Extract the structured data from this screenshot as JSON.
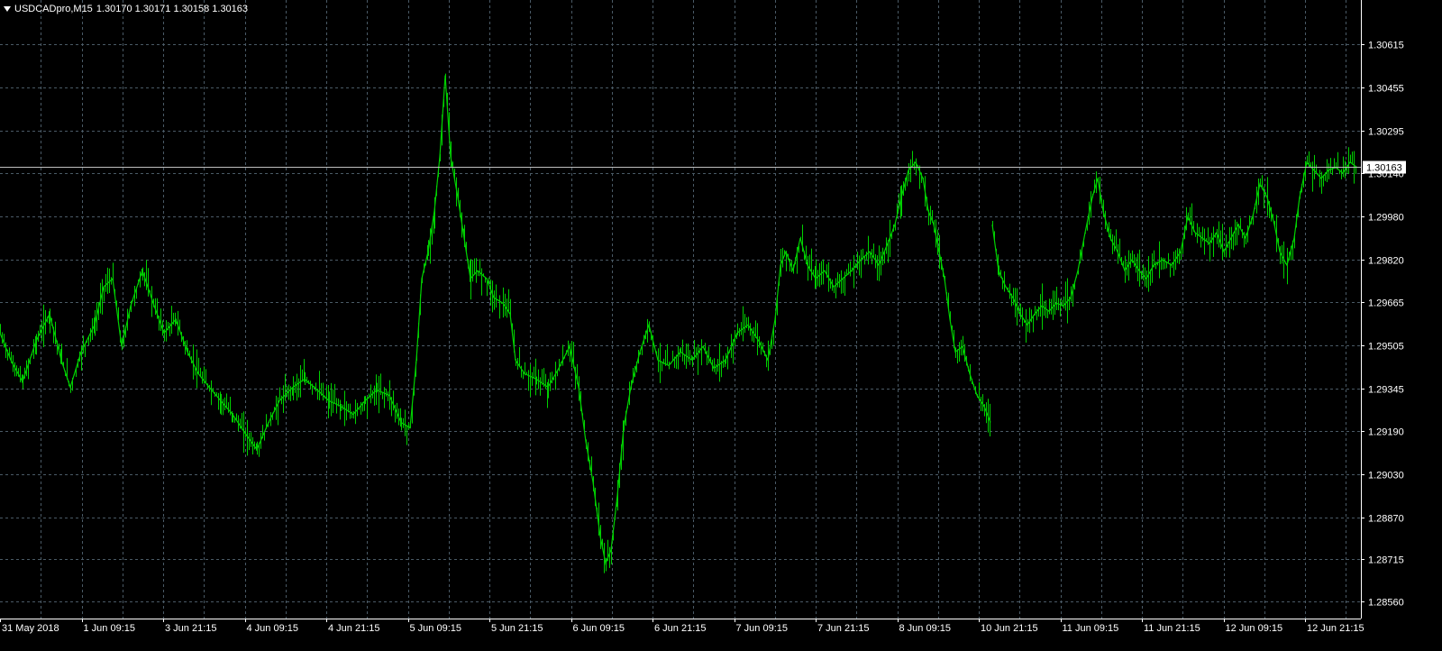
{
  "header": {
    "symbol": "USDCADpro",
    "timeframe": "M15",
    "symbol_timeframe": "USDCADpro,M15",
    "ohlc_text": "1.30170 1.30171 1.30158 1.30163"
  },
  "colors": {
    "background": "#000000",
    "grid": "#4a5a66",
    "bars": "#00d000",
    "axis_text": "#ffffff",
    "current_price_line": "#c0c0c0"
  },
  "current_price_label": "1.30163",
  "chart_data": {
    "type": "line",
    "title": "USDCADpro,M15",
    "ylim": [
      1.2852,
      1.3071
    ],
    "y_ticks": [
      "1.30615",
      "1.30455",
      "1.30295",
      "1.30140",
      "1.29980",
      "1.29820",
      "1.29665",
      "1.29505",
      "1.29345",
      "1.29190",
      "1.29030",
      "1.28870",
      "1.28715",
      "1.28560"
    ],
    "x_ticks": [
      "31 May 2018",
      "1 Jun 09:15",
      "3 Jun 21:15",
      "4 Jun 09:15",
      "4 Jun 21:15",
      "5 Jun 09:15",
      "5 Jun 21:15",
      "6 Jun 09:15",
      "6 Jun 21:15",
      "7 Jun 09:15",
      "7 Jun 21:15",
      "8 Jun 09:15",
      "10 Jun 21:15",
      "11 Jun 09:15",
      "11 Jun 21:15",
      "12 Jun 09:15",
      "12 Jun 21:15"
    ],
    "current_price": 1.30163,
    "series": [
      {
        "segments": [
          {
            "points": [
              [
                0,
                1.2955
              ],
              [
                12,
                1.2945
              ],
              [
                25,
                1.2937
              ],
              [
                40,
                1.2952
              ],
              [
                55,
                1.2962
              ],
              [
                68,
                1.2945
              ],
              [
                78,
                1.2935
              ],
              [
                90,
                1.2948
              ],
              [
                105,
                1.2958
              ],
              [
                115,
                1.2972
              ],
              [
                125,
                1.2975
              ],
              [
                135,
                1.295
              ],
              [
                145,
                1.2965
              ],
              [
                158,
                1.2978
              ],
              [
                170,
                1.2966
              ],
              [
                182,
                1.2955
              ],
              [
                195,
                1.296
              ],
              [
                208,
                1.2948
              ],
              [
                220,
                1.294
              ],
              [
                232,
                1.2935
              ],
              [
                245,
                1.293
              ],
              [
                258,
                1.2925
              ],
              [
                272,
                1.2918
              ],
              [
                285,
                1.2912
              ],
              [
                298,
                1.2922
              ],
              [
                310,
                1.293
              ],
              [
                325,
                1.2935
              ],
              [
                338,
                1.2938
              ],
              [
                352,
                1.2934
              ],
              [
                365,
                1.293
              ],
              [
                378,
                1.2928
              ],
              [
                392,
                1.2925
              ],
              [
                405,
                1.293
              ],
              [
                418,
                1.2934
              ],
              [
                432,
                1.2932
              ],
              [
                445,
                1.2922
              ],
              [
                455,
                1.292
              ],
              [
                462,
                1.2945
              ],
              [
                468,
                1.2975
              ],
              [
                475,
                1.2985
              ],
              [
                482,
                1.3
              ],
              [
                488,
                1.302
              ],
              [
                494,
                1.305
              ],
              [
                500,
                1.302
              ],
              [
                508,
                1.3005
              ],
              [
                515,
                1.299
              ],
              [
                522,
                1.2975
              ],
              [
                530,
                1.2978
              ],
              [
                540,
                1.2975
              ],
              [
                548,
                1.2968
              ],
              [
                558,
                1.2966
              ],
              [
                566,
                1.2962
              ],
              [
                572,
                1.2945
              ],
              [
                582,
                1.294
              ],
              [
                595,
                1.2938
              ],
              [
                608,
                1.2935
              ],
              [
                620,
                1.2942
              ],
              [
                632,
                1.295
              ],
              [
                642,
                1.2935
              ],
              [
                650,
                1.2915
              ],
              [
                658,
                1.29
              ],
              [
                666,
                1.288
              ],
              [
                672,
                1.287
              ],
              [
                678,
                1.2875
              ],
              [
                685,
                1.2895
              ],
              [
                692,
                1.292
              ],
              [
                700,
                1.2935
              ],
              [
                710,
                1.2948
              ],
              [
                720,
                1.2958
              ],
              [
                730,
                1.2945
              ],
              [
                742,
                1.2943
              ],
              [
                755,
                1.2948
              ],
              [
                768,
                1.2945
              ],
              [
                780,
                1.295
              ],
              [
                792,
                1.2942
              ],
              [
                805,
                1.2945
              ],
              [
                818,
                1.2955
              ],
              [
                830,
                1.2958
              ],
              [
                842,
                1.2952
              ],
              [
                852,
                1.2945
              ],
              [
                860,
                1.296
              ],
              [
                866,
                1.298
              ],
              [
                872,
                1.2985
              ],
              [
                880,
                1.2978
              ],
              [
                888,
                1.299
              ],
              [
                896,
                1.298
              ],
              [
                905,
                1.2975
              ],
              [
                915,
                1.2978
              ],
              [
                925,
                1.2972
              ],
              [
                935,
                1.2975
              ],
              [
                945,
                1.2978
              ],
              [
                955,
                1.2982
              ],
              [
                965,
                1.2985
              ],
              [
                975,
                1.298
              ],
              [
                985,
                1.2988
              ],
              [
                993,
                1.2995
              ],
              [
                1000,
                1.3005
              ],
              [
                1008,
                1.3015
              ],
              [
                1016,
                1.3018
              ],
              [
                1024,
                1.3012
              ],
              [
                1030,
                1.3
              ],
              [
                1036,
                1.2995
              ],
              [
                1042,
                1.2985
              ],
              [
                1048,
                1.2975
              ],
              [
                1054,
                1.296
              ],
              [
                1060,
                1.2948
              ],
              [
                1068,
                1.295
              ],
              [
                1076,
                1.294
              ],
              [
                1084,
                1.2932
              ],
              [
                1092,
                1.2928
              ],
              [
                1099,
                1.2922
              ]
            ]
          },
          {
            "points": [
              [
                1101,
                1.2995
              ],
              [
                1108,
                1.2978
              ],
              [
                1116,
                1.2972
              ],
              [
                1124,
                1.2968
              ],
              [
                1132,
                1.2962
              ],
              [
                1140,
                1.2958
              ],
              [
                1148,
                1.2962
              ],
              [
                1156,
                1.2965
              ],
              [
                1164,
                1.2963
              ],
              [
                1172,
                1.2966
              ],
              [
                1180,
                1.2965
              ],
              [
                1188,
                1.2968
              ],
              [
                1196,
                1.2978
              ],
              [
                1204,
                1.2992
              ],
              [
                1212,
                1.3005
              ],
              [
                1218,
                1.3012
              ],
              [
                1224,
                1.3
              ],
              [
                1232,
                1.299
              ],
              [
                1240,
                1.2985
              ],
              [
                1248,
                1.2978
              ],
              [
                1256,
                1.2982
              ],
              [
                1264,
                1.2978
              ],
              [
                1272,
                1.2975
              ],
              [
                1280,
                1.298
              ],
              [
                1290,
                1.2982
              ],
              [
                1300,
                1.298
              ],
              [
                1310,
                1.2985
              ],
              [
                1318,
                1.2998
              ],
              [
                1326,
                1.2992
              ],
              [
                1334,
                1.299
              ],
              [
                1342,
                1.2988
              ],
              [
                1350,
                1.2992
              ],
              [
                1358,
                1.2985
              ],
              [
                1366,
                1.299
              ],
              [
                1374,
                1.2995
              ],
              [
                1382,
                1.299
              ],
              [
                1390,
                1.2998
              ],
              [
                1398,
                1.301
              ],
              [
                1406,
                1.3005
              ],
              [
                1414,
                1.2995
              ],
              [
                1420,
                1.2985
              ],
              [
                1428,
                1.298
              ],
              [
                1436,
                1.299
              ],
              [
                1442,
                1.3005
              ],
              [
                1450,
                1.3018
              ],
              [
                1458,
                1.3015
              ],
              [
                1466,
                1.3012
              ],
              [
                1474,
                1.3015
              ],
              [
                1482,
                1.3016
              ],
              [
                1490,
                1.3014
              ],
              [
                1498,
                1.3018
              ],
              [
                1506,
                1.3016
              ]
            ]
          }
        ]
      }
    ]
  }
}
